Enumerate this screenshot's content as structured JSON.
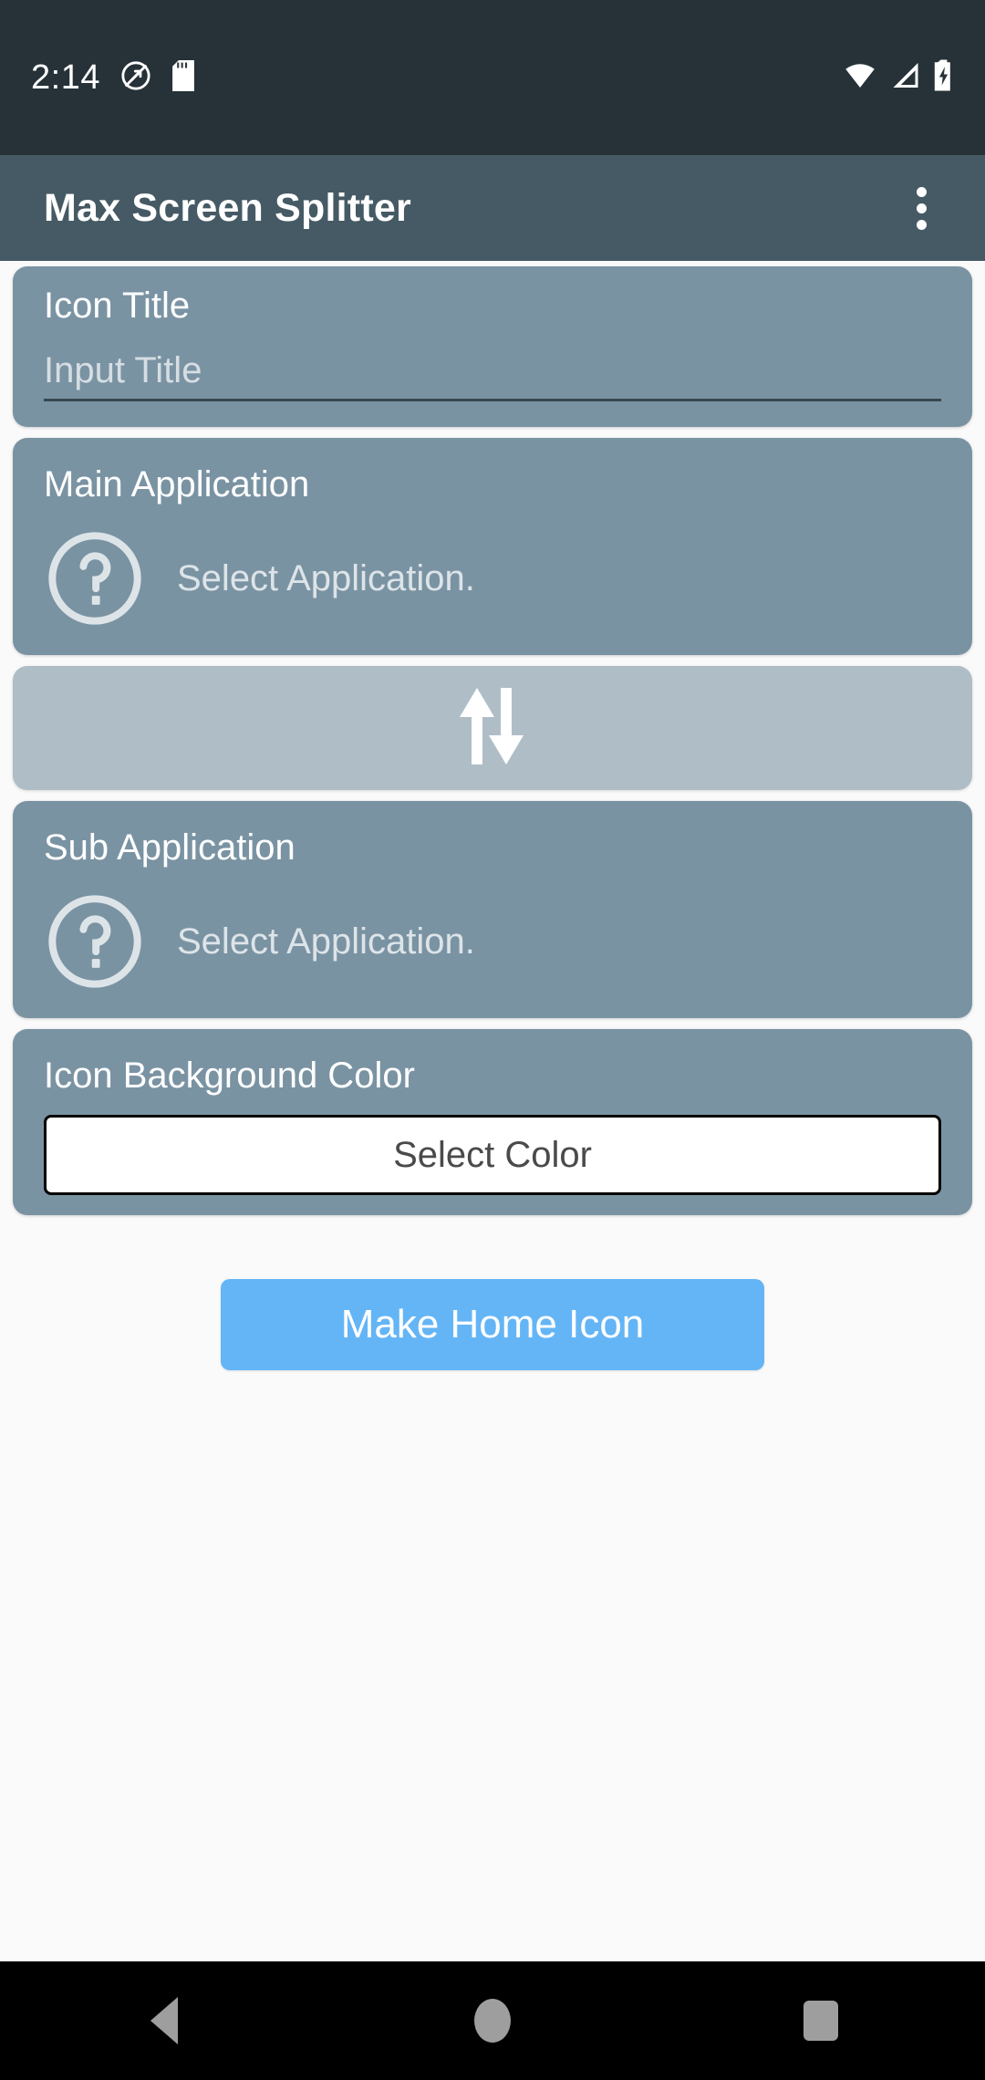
{
  "status_bar": {
    "time": "2:14",
    "left_icons": [
      "screen-record-icon",
      "sd-card-icon"
    ],
    "right_icons": [
      "wifi-icon",
      "cellular-signal-icon",
      "battery-charging-icon"
    ],
    "background_color": "#263238"
  },
  "app_bar": {
    "title": "Max Screen Splitter",
    "overflow_menu": "overflow-menu-icon",
    "background_color": "#455a64"
  },
  "cards": {
    "icon_title": {
      "label": "Icon Title",
      "input_value": "",
      "input_placeholder": "Input Title"
    },
    "main_application": {
      "label": "Main Application",
      "icon": "question-mark-circle-icon",
      "selected_text": "Select Application."
    },
    "swap": {
      "icon": "swap-vertical-icon",
      "background_color": "#afbdc6"
    },
    "sub_application": {
      "label": "Sub Application",
      "icon": "question-mark-circle-icon",
      "selected_text": "Select Application."
    },
    "icon_background_color": {
      "label": "Icon Background Color",
      "button_label": "Select Color"
    }
  },
  "primary_action": {
    "label": "Make Home Icon",
    "color": "#64b5f6"
  },
  "navigation_bar": {
    "back": "back-triangle-icon",
    "home": "home-circle-icon",
    "recents": "recents-square-icon"
  },
  "theme": {
    "card_color": "#7a93a3",
    "page_background": "#fafafa"
  }
}
